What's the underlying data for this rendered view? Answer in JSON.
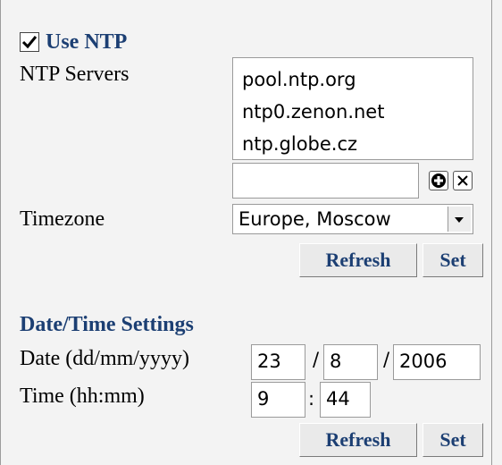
{
  "ntp": {
    "use_ntp_label": "Use NTP",
    "use_ntp_checked": true,
    "servers_label": "NTP Servers",
    "servers": [
      "pool.ntp.org",
      "ntp0.zenon.net",
      "ntp.globe.cz"
    ],
    "new_server_value": "",
    "add_icon": "plus-icon",
    "remove_icon": "close-icon",
    "timezone_label": "Timezone",
    "timezone_value": "Europe, Moscow",
    "refresh_label": "Refresh",
    "set_label": "Set"
  },
  "datetime": {
    "heading": "Date/Time Settings",
    "date_label": "Date (dd/mm/yyyy)",
    "day": "23",
    "month": "8",
    "year": "2006",
    "date_separator": "/",
    "time_label": "Time (hh:mm)",
    "hour": "9",
    "minute": "44",
    "time_separator": ":",
    "refresh_label": "Refresh",
    "set_label": "Set"
  },
  "colors": {
    "heading": "#1c3f73",
    "background": "#f3f3f3"
  }
}
